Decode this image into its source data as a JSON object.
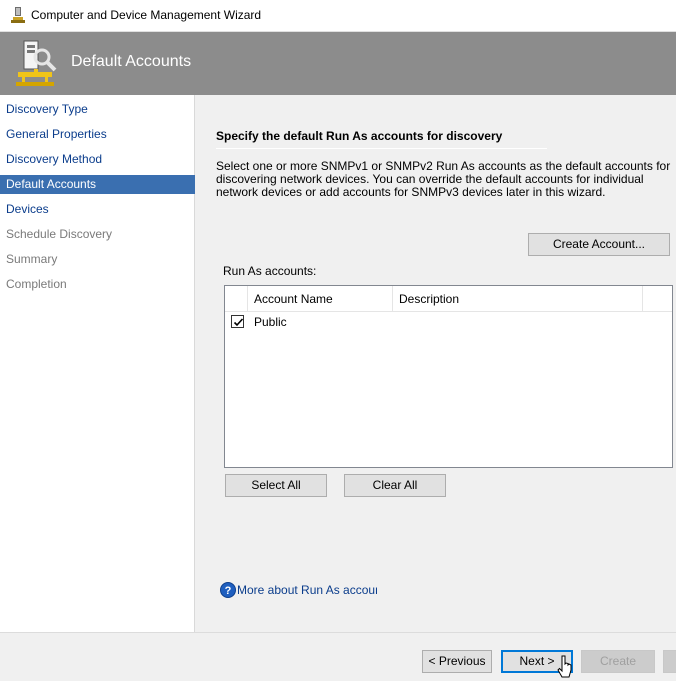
{
  "window": {
    "title": "Computer and Device Management Wizard"
  },
  "header": {
    "title": "Default Accounts"
  },
  "sidebar": {
    "items": [
      {
        "label": "Discovery Type",
        "state": "normal"
      },
      {
        "label": "General Properties",
        "state": "normal"
      },
      {
        "label": "Discovery Method",
        "state": "normal"
      },
      {
        "label": "Default Accounts",
        "state": "selected"
      },
      {
        "label": "Devices",
        "state": "normal"
      },
      {
        "label": "Schedule Discovery",
        "state": "disabled"
      },
      {
        "label": "Summary",
        "state": "disabled"
      },
      {
        "label": "Completion",
        "state": "disabled"
      }
    ]
  },
  "main": {
    "section_title": "Specify the default Run As accounts for discovery",
    "description": "Select one or more SNMPv1 or SNMPv2 Run As accounts as the default accounts for discovering network devices. You can override the default accounts for individual network devices or add accounts for SNMPv3 devices later in this wizard.",
    "create_account_label": "Create Account...",
    "runas_label": "Run As accounts:",
    "grid": {
      "columns": [
        "Account Name",
        "Description"
      ],
      "rows": [
        {
          "checked": true,
          "name": "Public",
          "description": ""
        }
      ]
    },
    "select_all_label": "Select All",
    "clear_all_label": "Clear All",
    "help_link": "More about Run As accounts"
  },
  "footer": {
    "previous_label": "< Previous",
    "next_label": "Next >",
    "create_label": "Create"
  },
  "colors": {
    "header_bg": "#8c8c8c",
    "selected_nav_bg": "#3a6fb0",
    "link": "#0b3d8c",
    "focus_border": "#0078d7"
  }
}
